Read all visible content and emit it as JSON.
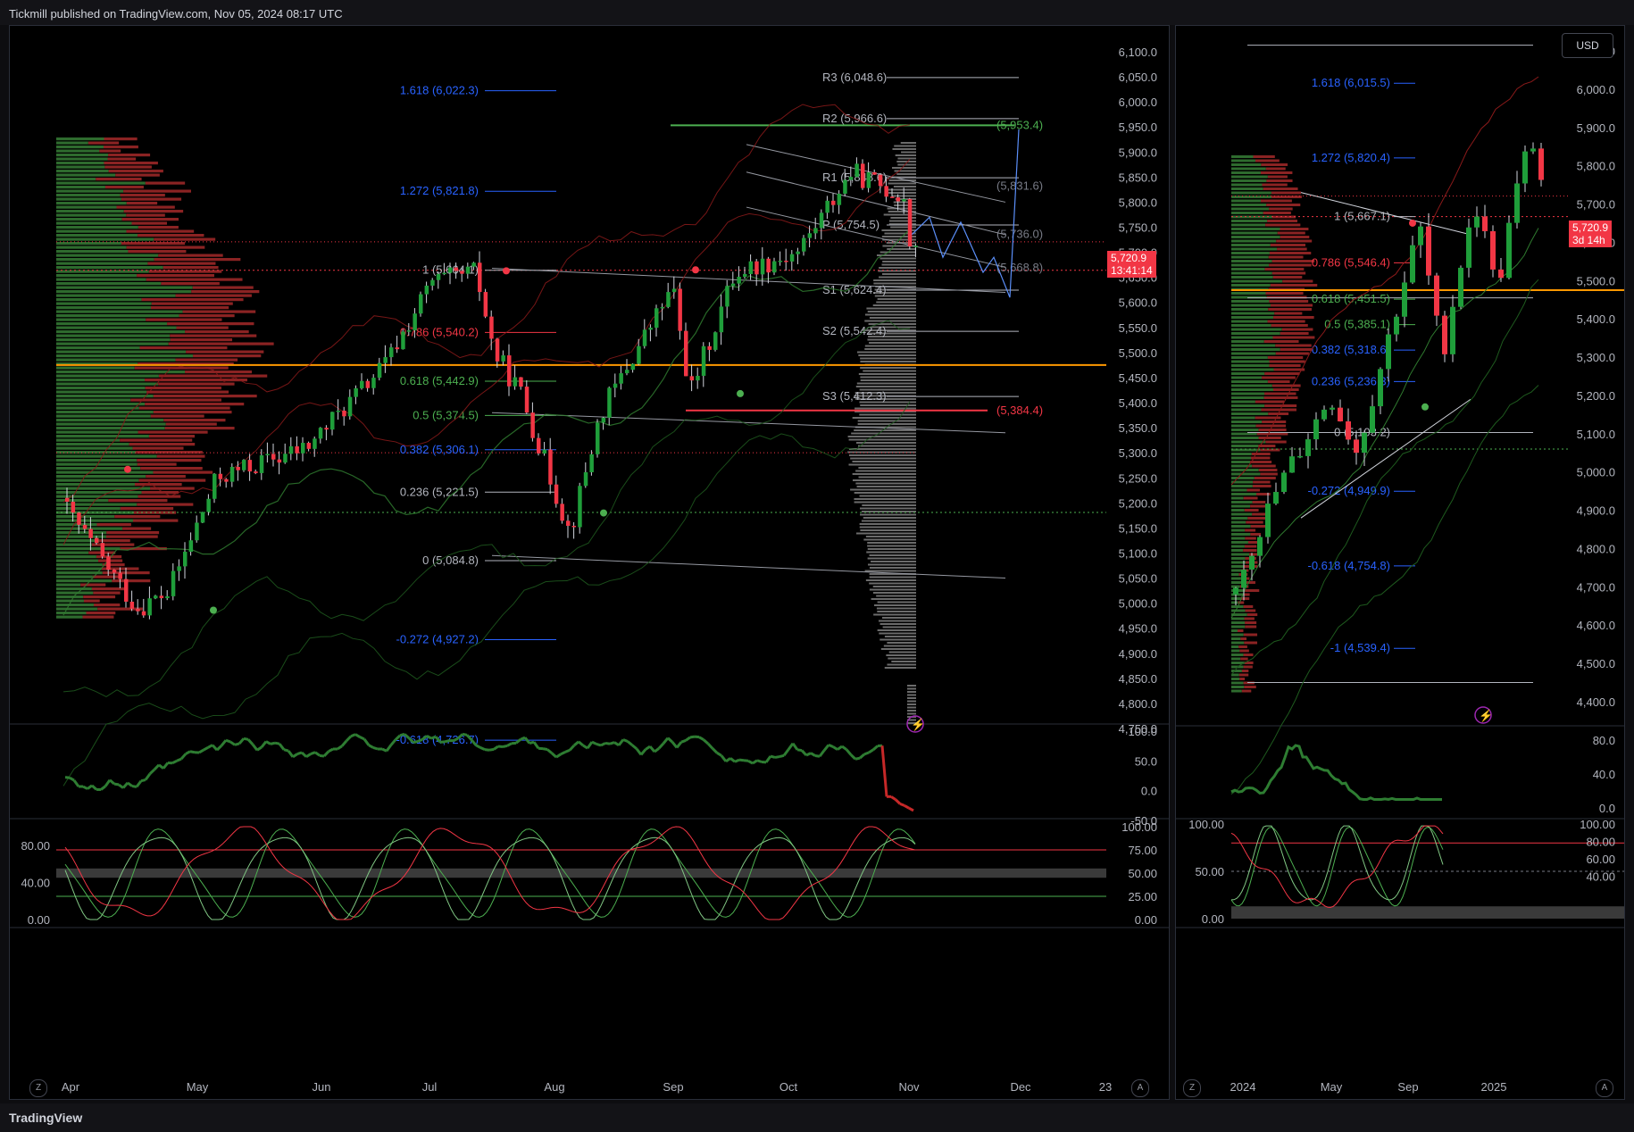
{
  "header": {
    "publisher_text": "Tickmill published on TradingView.com, Nov 05, 2024 08:17 UTC"
  },
  "footer": {
    "logo_text": "TradingView"
  },
  "left_chart": {
    "price_axis": [
      "6,100.0",
      "6,050.0",
      "6,000.0",
      "5,950.0",
      "5,900.0",
      "5,850.0",
      "5,800.0",
      "5,750.0",
      "5,700.0",
      "5,650.0",
      "5,600.0",
      "5,550.0",
      "5,500.0",
      "5,450.0",
      "5,400.0",
      "5,350.0",
      "5,300.0",
      "5,250.0",
      "5,200.0",
      "5,150.0",
      "5,100.0",
      "5,050.0",
      "5,000.0",
      "4,950.0",
      "4,900.0",
      "4,850.0",
      "4,800.0",
      "4,750.0"
    ],
    "time_axis": [
      "Apr",
      "May",
      "Jun",
      "Jul",
      "Aug",
      "Sep",
      "Oct",
      "Nov",
      "Dec",
      "23"
    ],
    "last_price": "5,720.9",
    "countdown": "13:41:14",
    "fib_levels": [
      {
        "label": "1.618 (6,022.3)",
        "color": "#2962ff"
      },
      {
        "label": "1.272 (5,821.8)",
        "color": "#2962ff"
      },
      {
        "label": "1 (5,664.1)",
        "color": "#b2b5be"
      },
      {
        "label": "0.786 (5,540.2)",
        "color": "#f23645"
      },
      {
        "label": "0.618 (5,442.9)",
        "color": "#4caf50"
      },
      {
        "label": "0.5 (5,374.5)",
        "color": "#4caf50"
      },
      {
        "label": "0.382 (5,306.1)",
        "color": "#2962ff"
      },
      {
        "label": "0.236 (5,221.5)",
        "color": "#b2b5be"
      },
      {
        "label": "0 (5,084.8)",
        "color": "#b2b5be"
      },
      {
        "label": "-0.272 (4,927.2)",
        "color": "#2962ff"
      },
      {
        "label": "-0.618 (4,726.7)",
        "color": "#2962ff"
      }
    ],
    "pivots": [
      "R3 (6,048.6)",
      "R2 (5,966.6)",
      "R1 (5,848.6)",
      "P (5,754.5)",
      "S1 (5,624.4)",
      "S2 (5,542.4)",
      "S3 (5,412.3)"
    ],
    "targets": [
      "(5,953.4)",
      "(5,831.6)",
      "(5,736.0)",
      "(5,668.8)",
      "(5,384.4)"
    ],
    "osc1_axis": [
      "100.0",
      "50.0",
      "0.0",
      "-50.0"
    ],
    "osc2_axis_right": [
      "100.00",
      "75.00",
      "50.00",
      "25.00",
      "0.00"
    ],
    "osc2_axis_left": [
      "80.00",
      "40.00",
      "0.00"
    ],
    "z_label": "Z",
    "a_label": "A"
  },
  "right_chart": {
    "usd_label": "USD",
    "price_axis": [
      "6,100.0",
      "6,000.0",
      "5,900.0",
      "5,800.0",
      "5,700.0",
      "5,600.0",
      "5,500.0",
      "5,400.0",
      "5,300.0",
      "5,200.0",
      "5,100.0",
      "5,000.0",
      "4,900.0",
      "4,800.0",
      "4,700.0",
      "4,600.0",
      "4,500.0",
      "4,400.0"
    ],
    "time_axis": [
      "2024",
      "May",
      "Sep",
      "2025"
    ],
    "last_price": "5,720.9",
    "countdown": "3d 14h",
    "fib_levels": [
      {
        "label": "1.618 (6,015.5)",
        "color": "#2962ff"
      },
      {
        "label": "1.272 (5,820.4)",
        "color": "#2962ff"
      },
      {
        "label": "1 (5,667.1)",
        "color": "#b2b5be"
      },
      {
        "label": "0.786 (5,546.4)",
        "color": "#f23645"
      },
      {
        "label": "0.618 (5,451.5)",
        "color": "#4caf50"
      },
      {
        "label": "0.5 (5,385.1)",
        "color": "#4caf50"
      },
      {
        "label": "0.382 (5,318.6)",
        "color": "#2962ff"
      },
      {
        "label": "0.236 (5,236.3)",
        "color": "#2962ff"
      },
      {
        "label": "0 (5,103.2)",
        "color": "#b2b5be"
      },
      {
        "label": "-0.272 (4,949.9)",
        "color": "#2962ff"
      },
      {
        "label": "-0.618 (4,754.8)",
        "color": "#2962ff"
      },
      {
        "label": "-1 (4,539.4)",
        "color": "#2962ff"
      }
    ],
    "osc1_axis": [
      "80.0",
      "40.0",
      "0.0"
    ],
    "osc2_axis_right": [
      "100.00",
      "80.00",
      "60.00",
      "40.00"
    ],
    "osc2_axis_left": [
      "100.00",
      "50.00",
      "0.00"
    ],
    "z_label": "Z",
    "a_label": "A"
  }
}
